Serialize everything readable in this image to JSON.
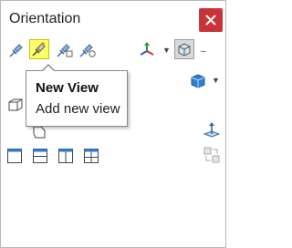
{
  "window": {
    "title": "Orientation"
  },
  "toolbar": {
    "buttons": [
      {
        "name": "view-pushpin-icon",
        "state": "normal"
      },
      {
        "name": "new-view-icon",
        "state": "highlighted"
      },
      {
        "name": "update-standard-views-icon",
        "state": "normal"
      },
      {
        "name": "reset-standard-views-icon",
        "state": "normal"
      },
      {
        "name": "view-selector-triad-icon",
        "state": "normal"
      },
      {
        "name": "view-cube-icon",
        "state": "selected"
      }
    ]
  },
  "tooltip": {
    "title": "New View",
    "description": "Add new view"
  },
  "colors": {
    "close": "#c9343a",
    "highlight": "#ffff66",
    "accent": "#2a7fd4"
  }
}
